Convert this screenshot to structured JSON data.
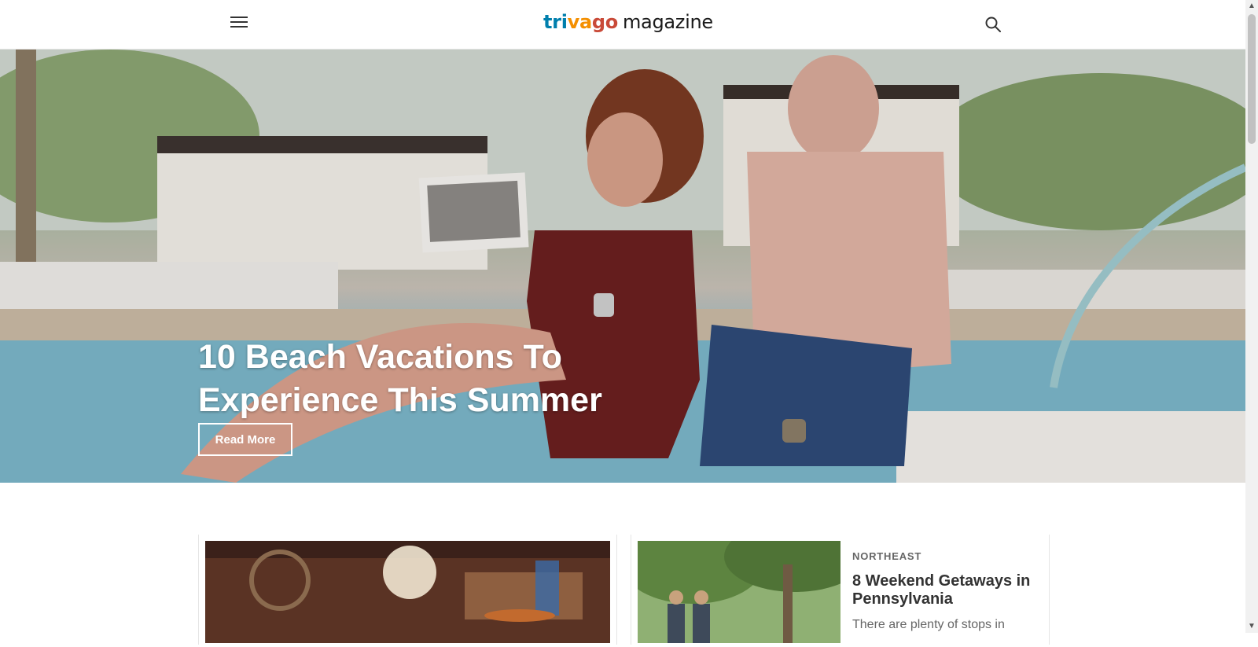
{
  "header": {
    "logo_parts": {
      "tri": "tri",
      "va": "va",
      "go": "go",
      "magazine": "magazine"
    }
  },
  "hero": {
    "title": "10 Beach Vacations To Experience This Summer",
    "cta_label": "Read More"
  },
  "cards": [
    {
      "category": "",
      "title": "",
      "excerpt": ""
    },
    {
      "category": "NORTHEAST",
      "title": "8 Weekend Getaways in Pennsylvania",
      "excerpt": "There are plenty of stops in"
    }
  ],
  "icons": {
    "menu": "hamburger-menu-icon",
    "search": "search-icon",
    "scroll_up": "chevron-up-icon",
    "scroll_down": "chevron-down-icon"
  },
  "colors": {
    "logo_tri": "#007fad",
    "logo_va": "#f48f00",
    "logo_go": "#c94a38",
    "text_dark": "#333333",
    "category": "#666666"
  }
}
